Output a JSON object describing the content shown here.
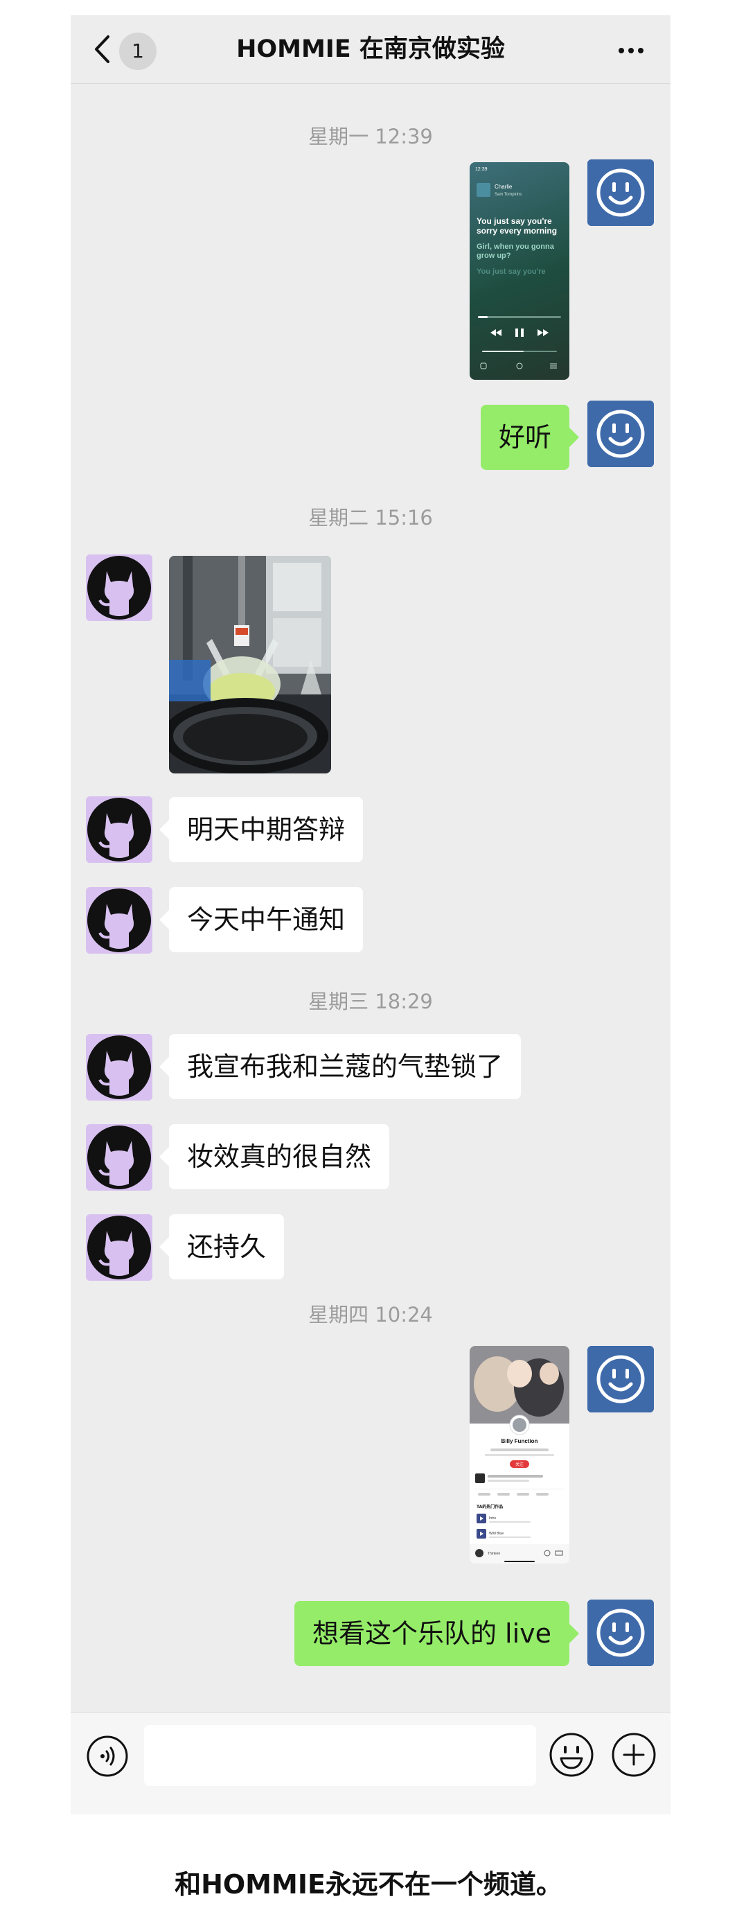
{
  "header": {
    "back_count": "1",
    "title": "HOMMIE 在南京做实验"
  },
  "timestamps": [
    "星期一 12:39",
    "星期二 15:16",
    "星期三 18:29",
    "星期四 10:24"
  ],
  "music_card": {
    "song": "Charlie",
    "artist": "Sam Tompkins",
    "lyric_active": "You just say you're sorry every morning",
    "lyric_next": "Girl, when you gonna grow up?",
    "lyric_faded": "You just say you're"
  },
  "messages": {
    "m1": "好听",
    "m2": "明天中期答辩",
    "m3": "今天中午通知",
    "m4": "我宣布我和兰蔻的气垫锁了",
    "m5": "妆效真的很自然",
    "m6": "还持久",
    "m7": "想看这个乐队的 live"
  },
  "profile_card": {
    "name": "Billy Function",
    "follow": "关注",
    "section": "TA的热门作品",
    "track1": "Intro",
    "track2": "Wild Blue",
    "player": "Thirteen"
  },
  "input": {
    "placeholder": ""
  },
  "caption": "和HOMMIE永远不在一个频道。",
  "colors": {
    "chat_bg": "#ededed",
    "outgoing_bubble": "#95ec69",
    "incoming_bubble": "#ffffff",
    "timestamp": "#9c9c9c",
    "cat_avatar_bg": "#d8c1f0",
    "smile_avatar_bg": "#3f6aaa"
  },
  "icons": [
    "back-icon",
    "more-icon",
    "voice-icon",
    "emoji-icon",
    "plus-icon",
    "github-cat-avatar",
    "smiley-avatar"
  ]
}
